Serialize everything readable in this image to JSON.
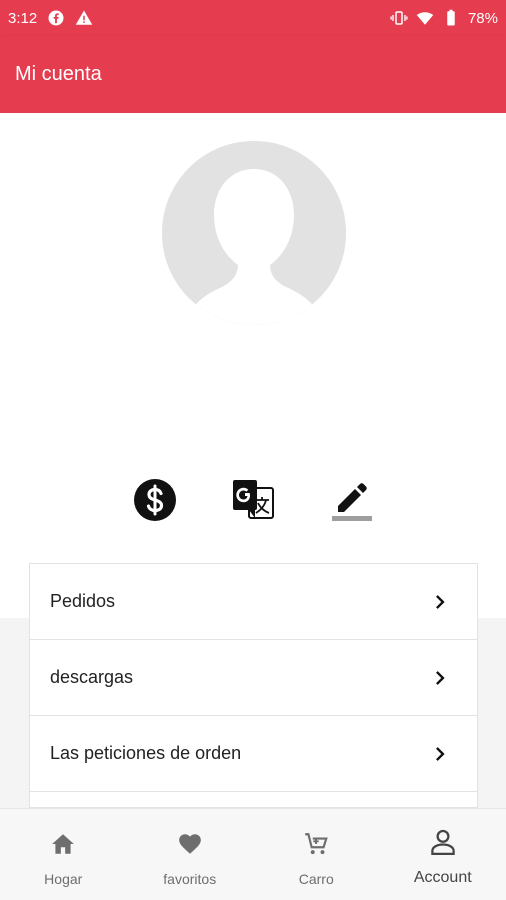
{
  "status_bar": {
    "time": "3:12",
    "battery": "78%",
    "left_icons": [
      "facebook-icon",
      "warning-icon"
    ],
    "right_icons": [
      "vibrate-icon",
      "wifi-icon",
      "battery-icon"
    ]
  },
  "app_bar": {
    "title": "Mi cuenta"
  },
  "profile": {
    "avatar_icon": "default-avatar-icon"
  },
  "actions": [
    {
      "name": "currency",
      "icon": "dollar-icon"
    },
    {
      "name": "language",
      "icon": "translate-icon"
    },
    {
      "name": "edit",
      "icon": "pencil-icon"
    }
  ],
  "menu": {
    "items": [
      {
        "label": "Pedidos"
      },
      {
        "label": "descargas"
      },
      {
        "label": "Las peticiones de orden"
      }
    ]
  },
  "bottom_nav": {
    "items": [
      {
        "label": "Hogar",
        "icon": "home-icon"
      },
      {
        "label": "favoritos",
        "icon": "heart-icon"
      },
      {
        "label": "Carro",
        "icon": "cart-icon"
      },
      {
        "label": "Account",
        "icon": "person-icon",
        "active": true
      }
    ]
  },
  "colors": {
    "brand": "#e53c4f",
    "nav_bg": "#f7f7f7"
  }
}
